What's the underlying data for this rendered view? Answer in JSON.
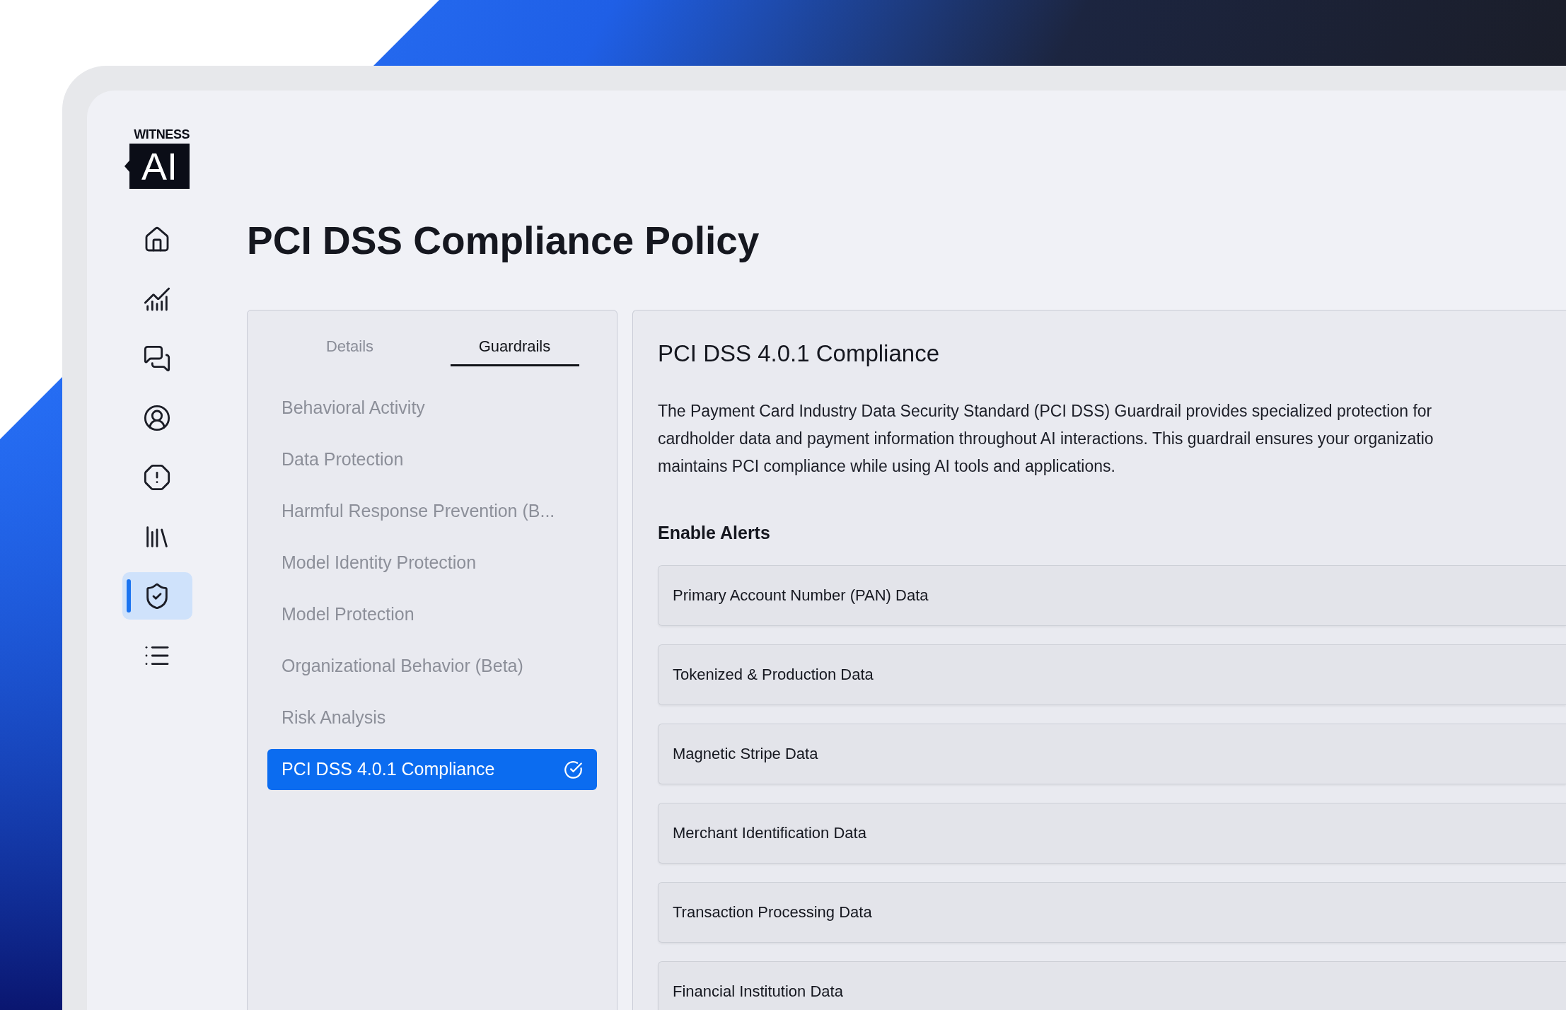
{
  "logo": {
    "wordmark": "WITNESS",
    "badge": "AI"
  },
  "sidebar": {
    "items": [
      {
        "kind": "home",
        "selected": false
      },
      {
        "kind": "analytics",
        "selected": false
      },
      {
        "kind": "chats",
        "selected": false
      },
      {
        "kind": "user",
        "selected": false
      },
      {
        "kind": "alert",
        "selected": false
      },
      {
        "kind": "library",
        "selected": false
      },
      {
        "kind": "shield",
        "selected": true
      },
      {
        "kind": "list",
        "selected": false
      }
    ]
  },
  "page": {
    "title": "PCI DSS Compliance Policy"
  },
  "tabs": [
    {
      "label": "Details",
      "selected": false
    },
    {
      "label": "Guardrails",
      "selected": true
    }
  ],
  "guardrails": [
    {
      "label": "Behavioral Activity",
      "selected": false
    },
    {
      "label": "Data Protection",
      "selected": false
    },
    {
      "label": "Harmful Response Prevention (B...",
      "selected": false
    },
    {
      "label": "Model Identity Protection",
      "selected": false
    },
    {
      "label": "Model Protection",
      "selected": false
    },
    {
      "label": "Organizational Behavior (Beta)",
      "selected": false
    },
    {
      "label": "Risk Analysis",
      "selected": false
    },
    {
      "label": "PCI DSS 4.0.1 Compliance",
      "selected": true
    }
  ],
  "detail": {
    "title": "PCI DSS 4.0.1 Compliance",
    "description_lines": [
      "The Payment Card Industry Data Security Standard (PCI DSS) Guardrail provides specialized protection for",
      "cardholder data and payment information throughout AI interactions. This guardrail ensures your organizatio",
      "maintains PCI compliance while using AI tools and applications."
    ],
    "alerts_heading": "Enable Alerts",
    "alerts": [
      "Primary Account Number (PAN) Data",
      "Tokenized & Production Data",
      "Magnetic Stripe Data",
      "Merchant Identification Data",
      "Transaction Processing Data",
      "Financial Institution Data"
    ]
  }
}
